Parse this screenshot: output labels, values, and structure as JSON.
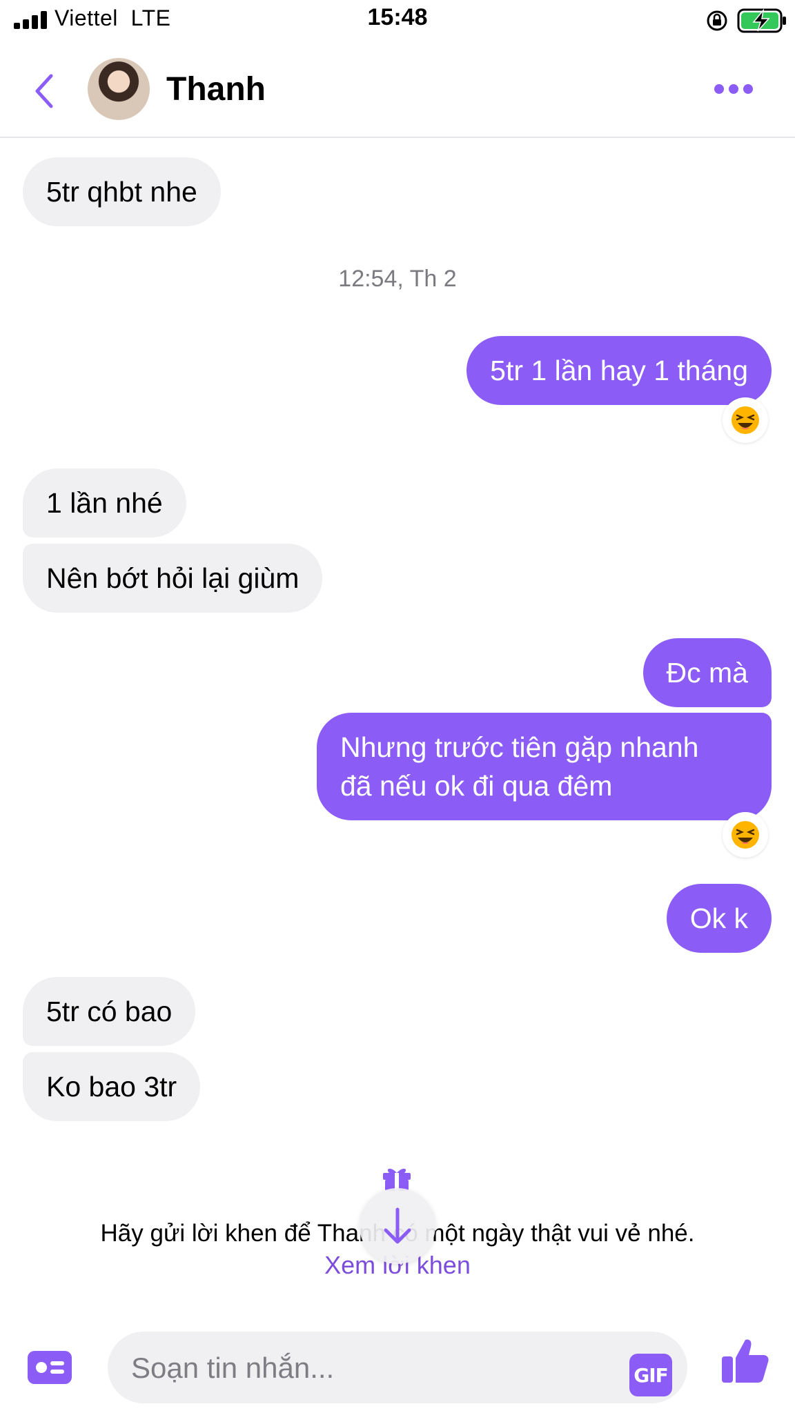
{
  "status_bar": {
    "carrier": "Viettel",
    "network": "LTE",
    "time": "15:48"
  },
  "header": {
    "contact_name": "Thanh"
  },
  "messages": {
    "m1": "5tr qhbt nhe",
    "timestamp": "12:54, Th 2",
    "m2": "5tr 1 lần hay 1 tháng",
    "m3": "1 lần nhé",
    "m4": "Nên bớt hỏi lại giùm",
    "m5": "Đc mà",
    "m6": "Nhưng trước tiên gặp nhanh\nđã nếu ok đi qua đêm",
    "m7": "Ok k",
    "m8": "5tr có bao",
    "m9": "Ko bao 3tr"
  },
  "compliment": {
    "prompt": "Hãy gửi lời khen để Thanh có một ngày thật vui vẻ nhé.",
    "link": "Xem lời khen"
  },
  "composer": {
    "placeholder": "Soạn tin nhắn...",
    "gif_label": "GIF"
  },
  "colors": {
    "accent": "#8b5cf6",
    "incoming_bubble": "#f0f0f2",
    "link": "#7c4ddb"
  }
}
